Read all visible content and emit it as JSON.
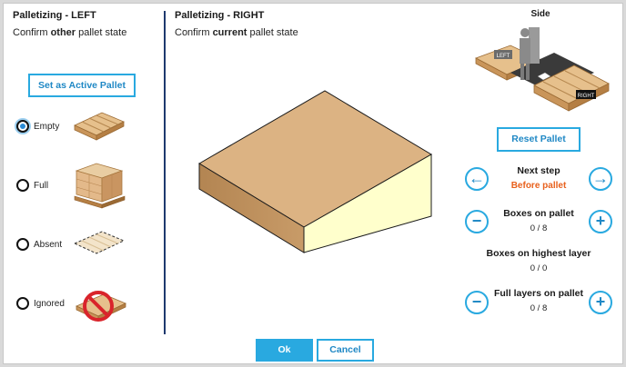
{
  "left": {
    "title": "Palletizing - LEFT",
    "subtitle_pre": "Confirm ",
    "subtitle_bold": "other",
    "subtitle_post": " pallet state",
    "set_active_label": "Set as Active Pallet",
    "options": [
      {
        "label": "Empty",
        "selected": true,
        "icon": "empty-pallet-icon"
      },
      {
        "label": "Full",
        "selected": false,
        "icon": "full-pallet-icon"
      },
      {
        "label": "Absent",
        "selected": false,
        "icon": "absent-pallet-icon"
      },
      {
        "label": "Ignored",
        "selected": false,
        "icon": "ignored-pallet-icon"
      }
    ]
  },
  "right": {
    "title": "Palletizing - RIGHT",
    "subtitle_pre": "Confirm ",
    "subtitle_bold": "current",
    "subtitle_post": " pallet state",
    "side_label": "Side",
    "side_left_tag": "LEFT",
    "side_right_tag": "RIGHT",
    "reset_label": "Reset Pallet",
    "next_step_title": "Next step",
    "next_step_value": "Before pallet",
    "boxes_on_pallet_title": "Boxes on pallet",
    "boxes_on_pallet_value": "0 / 8",
    "boxes_top_layer_title": "Boxes on highest layer",
    "boxes_top_layer_value": "0 / 0",
    "full_layers_title": "Full layers on pallet",
    "full_layers_value": "0 / 8"
  },
  "footer": {
    "ok_label": "Ok",
    "cancel_label": "Cancel"
  },
  "colors": {
    "accent": "#29a9e0",
    "highlight": "#e8601c",
    "divider": "#1e3a6e"
  }
}
